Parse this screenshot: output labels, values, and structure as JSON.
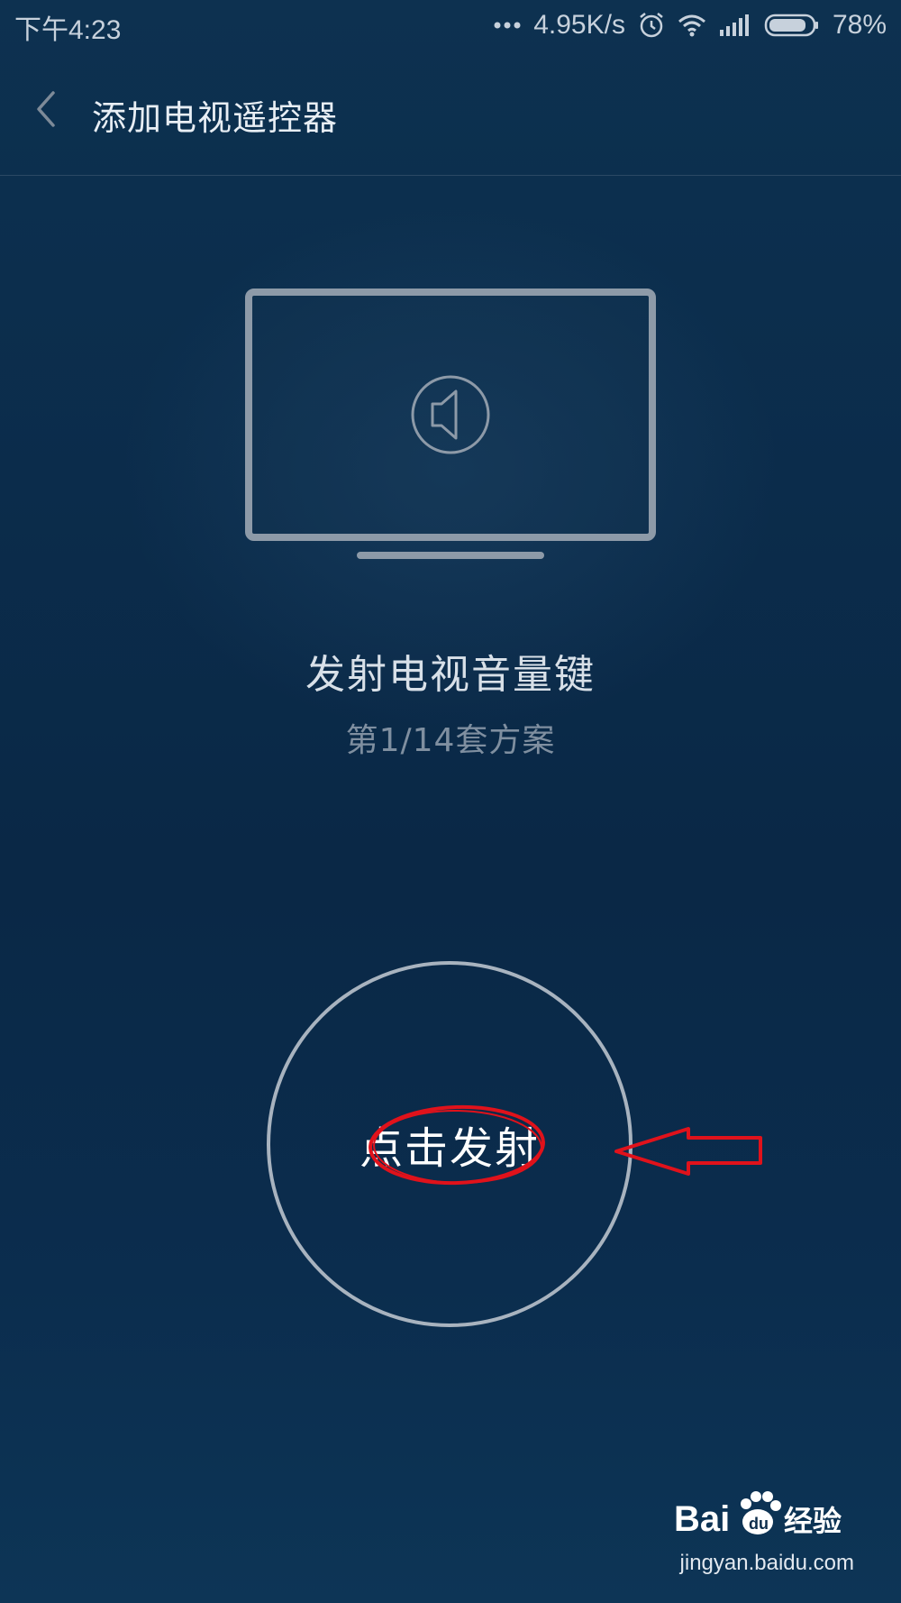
{
  "status_bar": {
    "time": "下午4:23",
    "network_speed": "4.95K/s",
    "battery": "78%",
    "icons": [
      "more-dots-icon",
      "alarm-icon",
      "wifi-icon",
      "signal-icon",
      "battery-icon"
    ]
  },
  "header": {
    "title": "添加电视遥控器",
    "back_icon": "chevron-left-icon"
  },
  "main": {
    "illustration_icon": "tv-volume-icon",
    "action_text": "发射电视音量键",
    "plan_text": "第1/14套方案",
    "fire_button_label": "点击发射"
  },
  "watermark": {
    "brand": "Baidu经验",
    "url": "jingyan.baidu.com"
  },
  "colors": {
    "background": "#0b2c4b",
    "annotation": "#e0121b",
    "circle_stroke": "#a8b3bf"
  }
}
